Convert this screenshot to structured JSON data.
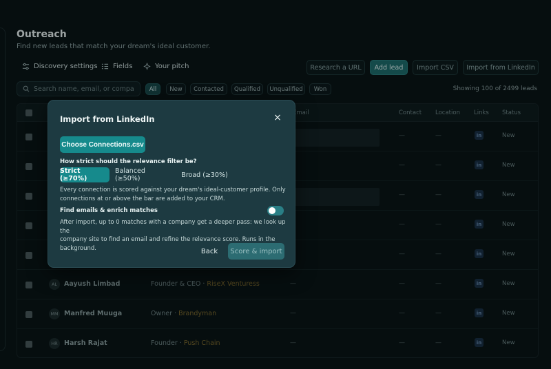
{
  "page": {
    "title": "Outreach",
    "subtitle": "Find new leads that match your dream's ideal customer."
  },
  "toolbar": {
    "discovery": "Discovery settings",
    "fields": "Fields",
    "pitch": "Your pitch",
    "research_url": "Research a URL",
    "add_lead": "Add lead",
    "import_csv": "Import CSV",
    "import_linkedin": "Import from LinkedIn"
  },
  "search": {
    "placeholder": "Search name, email, or company"
  },
  "filters": [
    "All",
    "New",
    "Contacted",
    "Qualified",
    "Unqualified",
    "Won"
  ],
  "showing": "Showing 100 of 2499 leads",
  "table": {
    "headers": {
      "email": "Email",
      "contact": "Contact",
      "location": "Location",
      "links": "Links",
      "status": "Status"
    },
    "rows": [
      {
        "initials": "",
        "name": "",
        "role": "",
        "company": "",
        "status": "New"
      },
      {
        "initials": "",
        "name": "",
        "role": "",
        "company": "",
        "status": "New"
      },
      {
        "initials": "",
        "name": "",
        "role": "",
        "company": "",
        "status": "New"
      },
      {
        "initials": "",
        "name": "",
        "role": "",
        "company": "",
        "status": "New"
      },
      {
        "initials": "",
        "name": "",
        "role": "",
        "company": "",
        "status": "New"
      },
      {
        "initials": "AL",
        "name": "Aayush Limbad",
        "role": "Founder & CEO",
        "company": "RiseX Venturess",
        "status": "New"
      },
      {
        "initials": "MM",
        "name": "Manfred Muuga",
        "role": "Owner",
        "company": "Brandyman",
        "status": "New"
      },
      {
        "initials": "HR",
        "name": "Harsh Rajat",
        "role": "Founder",
        "company": "Push Chain",
        "status": "New"
      }
    ],
    "dash": "—",
    "sep": "·",
    "li": "in"
  },
  "modal": {
    "title": "Import from LinkedIn",
    "choose": "Choose Connections.csv",
    "question": "How strict should the relevance filter be?",
    "options": [
      "Strict (≥70%)",
      "Balanced (≥50%)",
      "Broad (≥30%)"
    ],
    "desc1_line1": "Every connection is scored against your dream's ideal-customer profile. Only",
    "desc1_line2": "connections at or above the bar are added to your CRM.",
    "enrich_label": "Find emails & enrich matches",
    "desc2_line1": "After import, up to 0 matches with a company get a deeper pass: we look up the",
    "desc2_line2": "company site to find an email and refine the relevance score. Runs in the background.",
    "back": "Back",
    "score": "Score & import",
    "close": "×"
  }
}
